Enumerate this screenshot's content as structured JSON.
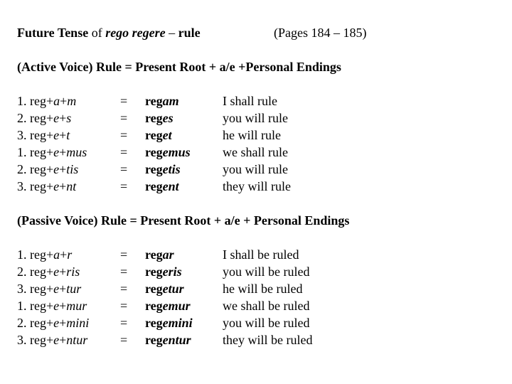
{
  "title": {
    "prefix": "Future Tense",
    "of": " of ",
    "verb": "rego regere",
    "dash": " – ",
    "meaning": "rule",
    "pages": "(Pages 184 – 185)"
  },
  "active": {
    "rule": "(Active Voice) Rule = Present Root + a/e +Personal Endings",
    "rows": [
      {
        "num": "1. reg+",
        "vowel": "a",
        "plus": "+",
        "ending": "m",
        "eq": "=",
        "stem": "reg",
        "form_ending": "am",
        "translation": "I shall rule"
      },
      {
        "num": "2. reg+",
        "vowel": "e",
        "plus": "+",
        "ending": "s",
        "eq": "=",
        "stem": "reg",
        "form_ending": "es",
        "translation": "you will rule"
      },
      {
        "num": "3. reg+",
        "vowel": "e",
        "plus": "+",
        "ending": "t",
        "eq": "=",
        "stem": "reg",
        "form_ending": "et",
        "translation": "he will rule"
      },
      {
        "num": "1. reg+",
        "vowel": "e",
        "plus": "+",
        "ending": "mus",
        "eq": "=",
        "stem": "reg",
        "form_ending": "emus",
        "translation": "we shall rule"
      },
      {
        "num": "2. reg+",
        "vowel": "e",
        "plus": "+",
        "ending": "tis",
        "eq": "=",
        "stem": "reg",
        "form_ending": "etis",
        "translation": "you will rule"
      },
      {
        "num": "3. reg+",
        "vowel": "e",
        "plus": "+",
        "ending": "nt",
        "eq": "=",
        "stem": "reg",
        "form_ending": "ent",
        "translation": "they will rule"
      }
    ]
  },
  "passive": {
    "rule": "(Passive Voice) Rule = Present Root + a/e + Personal Endings",
    "rows": [
      {
        "num": "1. reg+",
        "vowel": "a",
        "plus": "+",
        "ending": "r",
        "eq": "=",
        "stem": "reg",
        "form_ending": "ar",
        "translation": "I shall be ruled"
      },
      {
        "num": "2. reg+",
        "vowel": "e",
        "plus": "+",
        "ending": "ris",
        "eq": "=",
        "stem": "reg",
        "form_ending": "eris",
        "translation": "you will be ruled"
      },
      {
        "num": "3. reg+",
        "vowel": "e",
        "plus": "+",
        "ending": "tur",
        "eq": "=",
        "stem": "reg",
        "form_ending": "etur",
        "translation": "he will be ruled"
      },
      {
        "num": "1. reg+",
        "vowel": "e",
        "plus": "+",
        "ending": "mur",
        "eq": "=",
        "stem": "reg",
        "form_ending": "emur",
        "translation": "we shall be ruled"
      },
      {
        "num": "2. reg+",
        "vowel": "e",
        "plus": "+",
        "ending": "mini",
        "eq": "=",
        "stem": "reg",
        "form_ending": "emini",
        "translation": "you will be ruled"
      },
      {
        "num": "3. reg+",
        "vowel": "e",
        "plus": "+",
        "ending": "ntur",
        "eq": "=",
        "stem": "reg",
        "form_ending": "entur",
        "translation": "they will be ruled"
      }
    ]
  }
}
